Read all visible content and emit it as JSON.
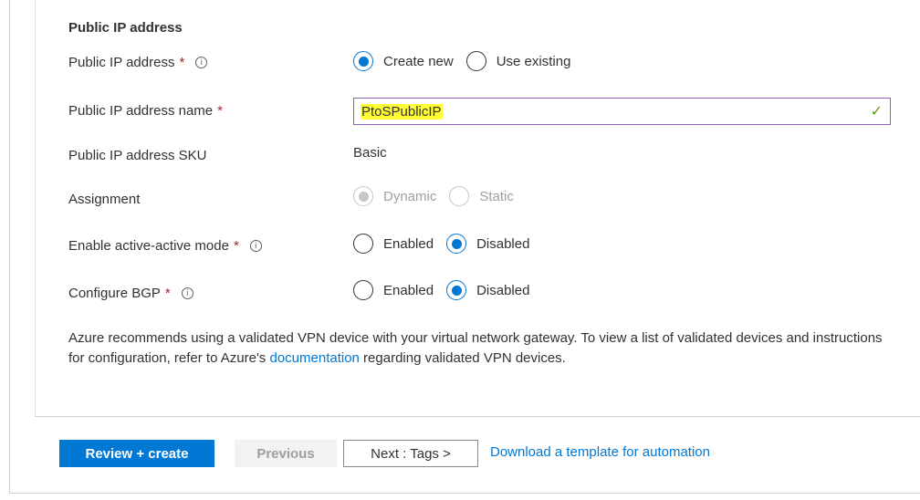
{
  "section": {
    "title": "Public IP address"
  },
  "public_ip": {
    "label": "Public IP address",
    "required": "*",
    "info": "i",
    "options": [
      "Create new",
      "Use existing"
    ],
    "selected": "Create new"
  },
  "ip_name": {
    "label": "Public IP address name",
    "required": "*",
    "value": "PtoSPublicIP",
    "valid_icon": "✓"
  },
  "sku": {
    "label": "Public IP address SKU",
    "value": "Basic"
  },
  "assignment": {
    "label": "Assignment",
    "options": [
      "Dynamic",
      "Static"
    ],
    "selected": "Dynamic",
    "disabled": true
  },
  "active_active": {
    "label": "Enable active-active mode",
    "required": "*",
    "info": "i",
    "options": [
      "Enabled",
      "Disabled"
    ],
    "selected": "Disabled"
  },
  "bgp": {
    "label": "Configure BGP",
    "required": "*",
    "info": "i",
    "options": [
      "Enabled",
      "Disabled"
    ],
    "selected": "Disabled"
  },
  "note": {
    "before": "Azure recommends using a validated VPN device with your virtual network gateway. To view a list of validated devices and instructions for configuration, refer to Azure's ",
    "link": "documentation",
    "after": " regarding validated VPN devices."
  },
  "footer": {
    "review_create": "Review + create",
    "previous": "Previous",
    "next": "Next : Tags >",
    "download_link": "Download a template for automation"
  },
  "colors": {
    "accent": "#0078d4",
    "highlight": "#ffff33",
    "valid": "#57a300"
  }
}
